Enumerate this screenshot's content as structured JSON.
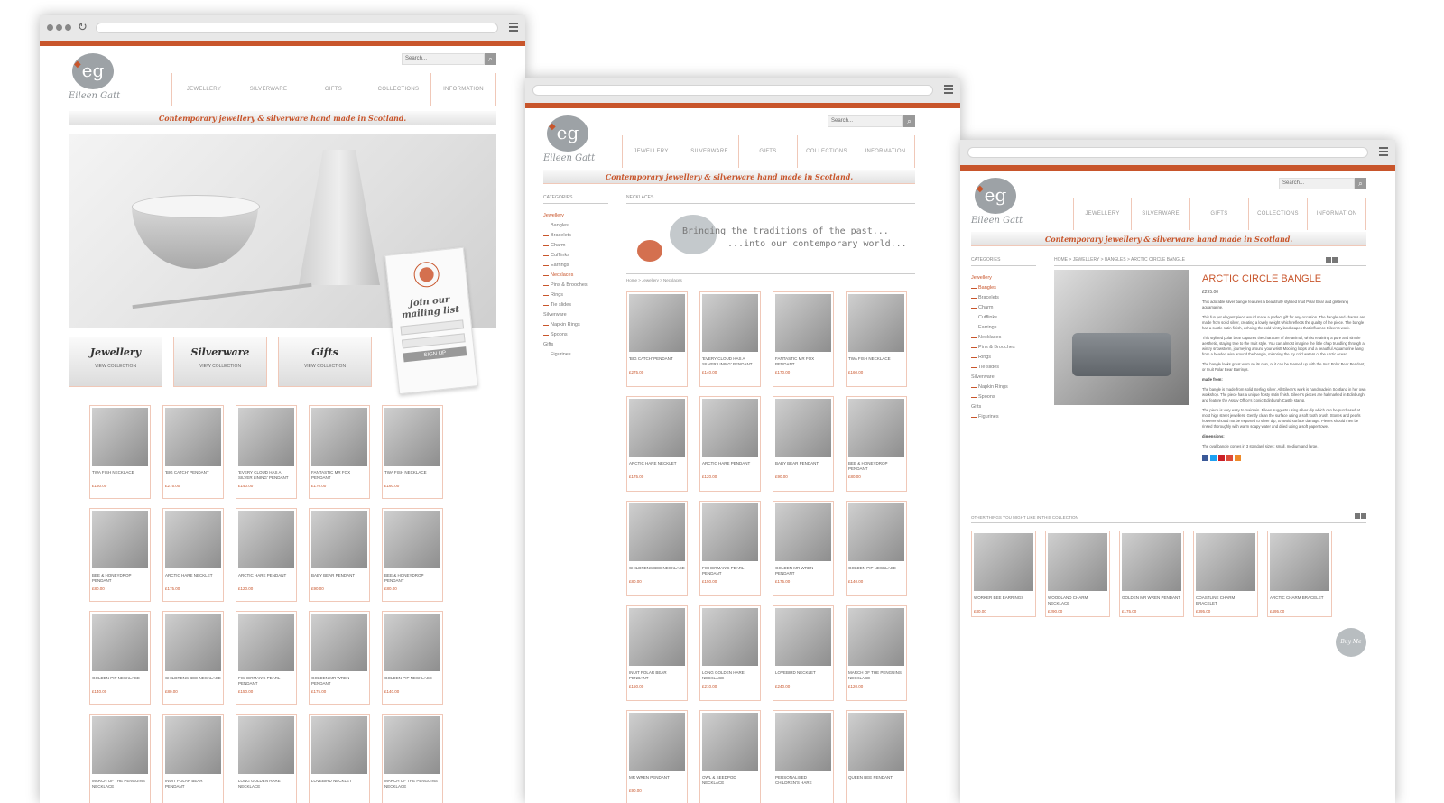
{
  "site": {
    "logo": "eg",
    "brand": "Eileen Gatt",
    "tagline": "Contemporary jewellery & silverware hand made  in Scotland.",
    "search_placeholder": "Search...",
    "nav": [
      "JEWELLERY",
      "SILVERWARE",
      "GIFTS",
      "COLLECTIONS",
      "INFORMATION"
    ]
  },
  "home": {
    "hero_tag": {
      "title": "Join our mailing list",
      "button": "SIGN UP"
    },
    "categories": [
      {
        "title": "Jewellery",
        "link": "VIEW COLLECTION"
      },
      {
        "title": "Silverware",
        "link": "VIEW COLLECTION"
      },
      {
        "title": "Gifts",
        "link": "VIEW COLLECTION"
      }
    ],
    "products": [
      {
        "name": "TWA FISH NECKLACE",
        "price": "£160.00"
      },
      {
        "name": "'BIG CATCH' PENDANT",
        "price": "£275.00"
      },
      {
        "name": "'EVERY CLOUD HAS A SILVER LINING' PENDANT",
        "price": "£140.00"
      },
      {
        "name": "FANTASTIC MR FOX PENDANT",
        "price": "£170.00"
      },
      {
        "name": "TWA FISH NECKLACE",
        "price": "£160.00"
      },
      {
        "name": "BEE & HONEYDROP PENDANT",
        "price": "£80.00"
      },
      {
        "name": "ARCTIC HARE NECKLET",
        "price": "£175.00"
      },
      {
        "name": "ARCTIC HARE PENDANT",
        "price": "£120.00"
      },
      {
        "name": "BABY BEAR PENDANT",
        "price": "£90.00"
      },
      {
        "name": "BEE & HONEYDROP PENDANT",
        "price": "£80.00"
      },
      {
        "name": "GOLDEN PIP NECKLACE",
        "price": "£140.00"
      },
      {
        "name": "CHILDRENS BEE NECKLACE",
        "price": "£80.00"
      },
      {
        "name": "FISHERMAN'S PEARL PENDANT",
        "price": "£150.00"
      },
      {
        "name": "GOLDEN MR WREN PENDANT",
        "price": "£175.00"
      },
      {
        "name": "GOLDEN PIP NECKLACE",
        "price": "£140.00"
      },
      {
        "name": "MARCH OF THE PENGUINS NECKLACE",
        "price": ""
      },
      {
        "name": "INUIT POLAR BEAR PENDANT",
        "price": ""
      },
      {
        "name": "LONG GOLDEN HARE NECKLACE",
        "price": ""
      },
      {
        "name": "LOVEBIRD NECKLET",
        "price": ""
      },
      {
        "name": "MARCH OF THE PENGUINS NECKLACE",
        "price": ""
      }
    ]
  },
  "category": {
    "sidebar_title": "CATEGORIES",
    "main_title": "NECKLACES",
    "banner_quote": [
      "Bringing the traditions of the past...",
      "...into our contemporary world..."
    ],
    "breadcrumb": "Home  >  Jewellery  >  Necklaces",
    "sidebar": [
      {
        "label": "Jewellery",
        "style": "hot"
      },
      {
        "label": "Bangles",
        "style": "sub"
      },
      {
        "label": "Bracelets",
        "style": "sub"
      },
      {
        "label": "Charm",
        "style": "sub"
      },
      {
        "label": "Cufflinks",
        "style": "sub"
      },
      {
        "label": "Earrings",
        "style": "sub"
      },
      {
        "label": "Necklaces",
        "style": "subhot"
      },
      {
        "label": "Pins & Brooches",
        "style": "sub"
      },
      {
        "label": "Rings",
        "style": "sub"
      },
      {
        "label": "Tie slides",
        "style": "sub"
      },
      {
        "label": "Silverware",
        "style": "g"
      },
      {
        "label": "Napkin Rings",
        "style": "sub"
      },
      {
        "label": "Spoons",
        "style": "sub"
      },
      {
        "label": "Gifts",
        "style": "g"
      },
      {
        "label": "Figurines",
        "style": "sub"
      }
    ],
    "products": [
      {
        "name": "'BIG CATCH' PENDANT",
        "price": "£275.00"
      },
      {
        "name": "'EVERY CLOUD HAS A SILVER LINING' PENDANT",
        "price": "£140.00"
      },
      {
        "name": "FANTASTIC MR FOX PENDANT",
        "price": "£170.00"
      },
      {
        "name": "TWA FISH NECKLACE",
        "price": "£160.00"
      },
      {
        "name": "ARCTIC HARE NECKLET",
        "price": "£175.00"
      },
      {
        "name": "ARCTIC HARE PENDANT",
        "price": "£120.00"
      },
      {
        "name": "BABY BEAR PENDANT",
        "price": "£90.00"
      },
      {
        "name": "BEE & HONEYDROP PENDANT",
        "price": "£80.00"
      },
      {
        "name": "CHILDRENS BEE NECKLACE",
        "price": "£80.00"
      },
      {
        "name": "FISHERMAN'S PEARL PENDANT",
        "price": "£150.00"
      },
      {
        "name": "GOLDEN MR WREN PENDANT",
        "price": "£175.00"
      },
      {
        "name": "GOLDEN PIP NECKLACE",
        "price": "£140.00"
      },
      {
        "name": "INUIT POLAR BEAR PENDANT",
        "price": "£150.00"
      },
      {
        "name": "LONG GOLDEN HARE NECKLACE",
        "price": "£210.00"
      },
      {
        "name": "LOVEBIRD NECKLET",
        "price": "£240.00"
      },
      {
        "name": "MARCH OF THE PENGUINS NECKLACE",
        "price": "£120.00"
      },
      {
        "name": "MR WREN PENDANT",
        "price": "£90.00"
      },
      {
        "name": "OWL & SEEDPOD NECKLACE",
        "price": ""
      },
      {
        "name": "PERSONALISED CHILDREN'S HARE NECKLACE",
        "price": ""
      },
      {
        "name": "QUEEN BEE PENDANT",
        "price": ""
      }
    ]
  },
  "product": {
    "breadcrumb": "HOME  >  JEWELLERY  >  BANGLES  >  ARCTIC CIRCLE BANGLE",
    "title": "ARCTIC CIRCLE BANGLE",
    "price": "£295.00",
    "paragraphs": [
      "This adorable silver bangle features a beautifully stylised Inuit Polar Bear and glistening aquamarine.",
      "This fun yet elegant piece would make a perfect gift for any occasion. The bangle and charms are made from solid silver, creating a lovely weight which reflects the quality of the piece. The bangle has a subtle satin finish, echoing the cold wintry landscapes that influence Eileen's work.",
      "This stylised polar bear captures the character of the animal, whilst retaining a pure and simple aesthetic, staying true to the Inuit style. You can almost imagine the little chap trundling through a wintry snowstorm, journeying around your wrist! Mooring loops and a beautiful Aquamarine hang from a beaded wire around the bangle, mirroring the icy cold waters of the Arctic ocean.",
      "The bangle looks great worn on its own, or it can be teamed up with the Inuit Polar Bear Pendant, or Inuit Polar Bear Earrings."
    ],
    "made_from_label": "made from:",
    "made_from": [
      "The bangle is made from solid sterling silver. All Eileen's work is handmade in Scotland in her own workshop. The piece has a unique frosty satin finish. Eileen's pieces are hallmarked in Edinburgh, and feature the Assay Office's iconic Edinburgh Castle stamp.",
      "The piece is very easy to maintain. Eileen suggests using silver dip which can be purchased at most high street jewellers. Gently clean the surface using a soft tooth brush. Stones and pearls however should not be exposed to silver dip, to avoid surface damage. Pieces should then be rinsed thoroughly with warm soapy water and dried using a soft paper towel."
    ],
    "dimensions_label": "dimensions:",
    "dimensions": "The oval bangle comes in 3 standard sizes; small, medium and large.",
    "buy": "Buy Me",
    "related_title": "OTHER THINGS YOU MIGHT LIKE IN THIS COLLECTION",
    "related": [
      {
        "name": "WORKER BEE EARRINGS",
        "price": "£80.00"
      },
      {
        "name": "WOODLAND CHARM NECKLACE",
        "price": "£290.00"
      },
      {
        "name": "GOLDEN MR WREN PENDANT",
        "price": "£175.00"
      },
      {
        "name": "COASTLINE CHARM BRACELET",
        "price": "£395.00"
      },
      {
        "name": "ARCTIC CHARM BRACELET",
        "price": "£495.00"
      }
    ],
    "share_colors": [
      "#3b5998",
      "#1da1f2",
      "#cb2027",
      "#dd4b39",
      "#ee8a2a"
    ]
  },
  "colors": {
    "accent": "#c8552b",
    "logo_grey": "#9da2a6"
  }
}
